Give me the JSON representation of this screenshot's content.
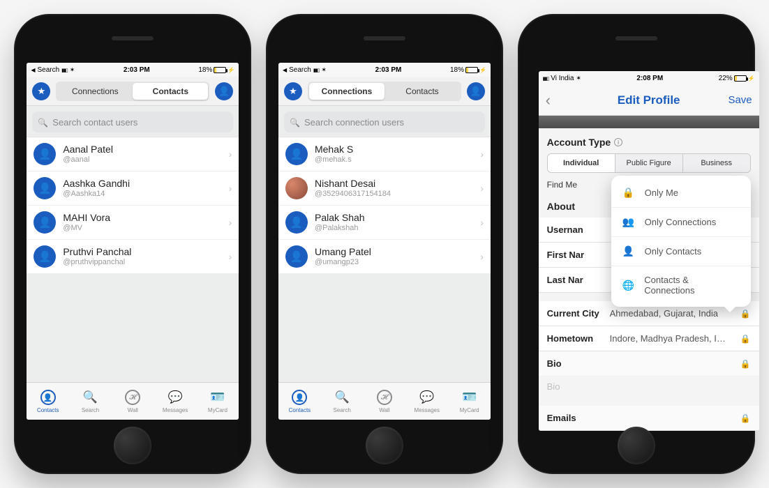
{
  "phone1": {
    "status": {
      "back_app": "Search",
      "time": "2:03 PM",
      "battery": "18%"
    },
    "tabs": {
      "connections": "Connections",
      "contacts": "Contacts",
      "active": "contacts"
    },
    "search_placeholder": "Search contact users",
    "contacts": [
      {
        "name": "Aanal Patel",
        "handle": "@aanal"
      },
      {
        "name": "Aashka Gandhi",
        "handle": "@Aashka14"
      },
      {
        "name": "MAHI Vora",
        "handle": "@MV"
      },
      {
        "name": "Pruthvi Panchal",
        "handle": "@pruthvippanchal"
      }
    ],
    "tabbar": {
      "contacts": "Contacts",
      "search": "Search",
      "wall": "Wall",
      "messages": "Messages",
      "mycard": "MyCard"
    }
  },
  "phone2": {
    "status": {
      "back_app": "Search",
      "time": "2:03 PM",
      "battery": "18%"
    },
    "tabs": {
      "connections": "Connections",
      "contacts": "Contacts",
      "active": "connections"
    },
    "search_placeholder": "Search connection users",
    "contacts": [
      {
        "name": "Mehak S",
        "handle": "@mehak.s"
      },
      {
        "name": "Nishant Desai",
        "handle": "@3529406317154184",
        "photo": true
      },
      {
        "name": "Palak Shah",
        "handle": "@Palakshah"
      },
      {
        "name": "Umang Patel",
        "handle": "@umangp23"
      }
    ],
    "tabbar": {
      "contacts": "Contacts",
      "search": "Search",
      "wall": "Wall",
      "messages": "Messages",
      "mycard": "MyCard"
    }
  },
  "phone3": {
    "status": {
      "carrier": "Vi India",
      "time": "2:08 PM",
      "battery": "22%"
    },
    "nav": {
      "title": "Edit Profile",
      "save": "Save"
    },
    "account_type_label": "Account Type",
    "account_types": {
      "individual": "Individual",
      "public_figure": "Public Figure",
      "business": "Business"
    },
    "find_me_label": "Find Me",
    "about_label": "About",
    "fields": {
      "username_label": "Usernan",
      "firstname_label": "First Nar",
      "lastname_label": "Last Nar",
      "current_city_label": "Current City",
      "current_city_value": "Ahmedabad, Gujarat, India",
      "hometown_label": "Hometown",
      "hometown_value": "Indore, Madhya Pradesh, I…"
    },
    "bio_label": "Bio",
    "bio_placeholder": "Bio",
    "emails_label": "Emails",
    "popover": {
      "only_me": "Only Me",
      "only_connections": "Only Connections",
      "only_contacts": "Only Contacts",
      "both": "Contacts & Connections"
    }
  }
}
